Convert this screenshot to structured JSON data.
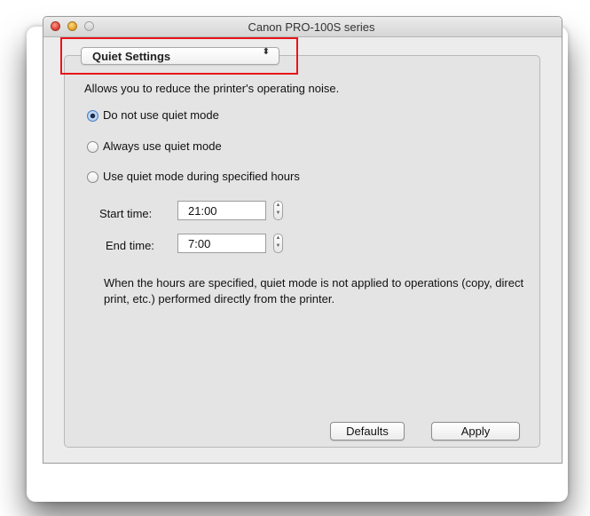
{
  "window": {
    "title": "Canon PRO-100S series"
  },
  "popup": {
    "selected": "Quiet Settings",
    "arrows": "⬍"
  },
  "description": "Allows you to reduce the printer's operating noise.",
  "radios": [
    {
      "label": "Do not use quiet mode",
      "selected": true
    },
    {
      "label": "Always use quiet mode",
      "selected": false
    },
    {
      "label": "Use quiet mode during specified hours",
      "selected": false
    }
  ],
  "start_time": {
    "label": "Start time:",
    "value": "21:00"
  },
  "end_time": {
    "label": "End time:",
    "value": "7:00"
  },
  "note": "When the hours are specified, quiet mode is not applied to operations (copy, direct print, etc.) performed directly from the printer.",
  "buttons": {
    "defaults": "Defaults",
    "apply": "Apply"
  },
  "colors": {
    "highlight": "#e8141a",
    "radio_accent": "#4a7ec2"
  }
}
